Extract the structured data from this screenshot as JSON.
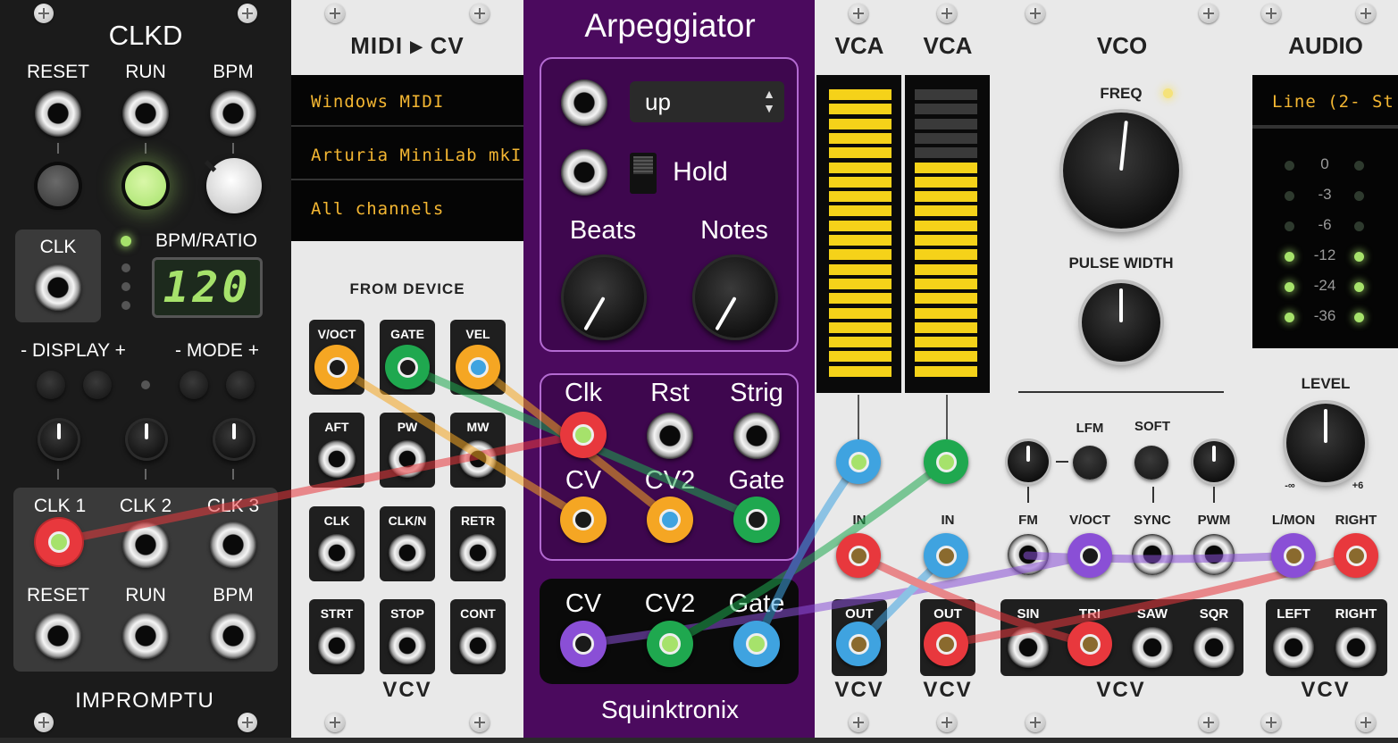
{
  "clkd": {
    "title": "CLKD",
    "top_labels": [
      "RESET",
      "RUN",
      "BPM"
    ],
    "clk_label": "CLK",
    "bpm_ratio_label": "BPM/RATIO",
    "display_value": "120",
    "display_label": "- DISPLAY +",
    "mode_label": "- MODE +",
    "out_labels": [
      "CLK 1",
      "CLK 2",
      "CLK 3"
    ],
    "bottom_labels": [
      "RESET",
      "RUN",
      "BPM"
    ],
    "brand": "IMPROMPTU"
  },
  "midicv": {
    "title": "MIDI ▸ CV",
    "driver": "Windows MIDI",
    "device": "Arturia MiniLab mkI",
    "channel": "All channels",
    "section_label": "FROM DEVICE",
    "outputs": [
      "V/OCT",
      "GATE",
      "VEL",
      "AFT",
      "PW",
      "MW",
      "CLK",
      "CLK/N",
      "RETR",
      "STRT",
      "STOP",
      "CONT"
    ],
    "brand": "VCV"
  },
  "arp": {
    "title": "Arpeggiator",
    "mode_value": "up",
    "hold_label": "Hold",
    "beats_label": "Beats",
    "notes_label": "Notes",
    "inputs": [
      "Clk",
      "Rst",
      "Strig",
      "CV",
      "CV2",
      "Gate"
    ],
    "outputs": [
      "CV",
      "CV2",
      "Gate"
    ],
    "brand": "Squinktronix"
  },
  "vca1": {
    "title": "VCA",
    "in_label": "IN",
    "out_label": "OUT",
    "brand": "VCV",
    "level": 1.0
  },
  "vca2": {
    "title": "VCA",
    "in_label": "IN",
    "out_label": "OUT",
    "brand": "VCV",
    "level": 0.75
  },
  "vco": {
    "title": "VCO",
    "freq_label": "FREQ",
    "pw_label": "PULSE WIDTH",
    "lfm_label": "LFM",
    "soft_label": "SOFT",
    "inputs": [
      "FM",
      "V/OCT",
      "SYNC",
      "PWM"
    ],
    "outputs": [
      "SIN",
      "TRI",
      "SAW",
      "SQR"
    ],
    "brand": "VCV"
  },
  "audio": {
    "title": "AUDIO",
    "device": "Line (2- St",
    "meter_labels": [
      "0",
      "-3",
      "-6",
      "-12",
      "-24",
      "-36"
    ],
    "level_label": "LEVEL",
    "level_min": "-∞",
    "level_max": "+6",
    "inputs": [
      "L/MON",
      "RIGHT"
    ],
    "outputs": [
      "LEFT",
      "RIGHT"
    ],
    "brand": "VCV"
  },
  "colors": {
    "yellow": "#f5d219",
    "purple": "#4a0b5c",
    "cable_red": "#e8383d",
    "cable_orange": "#f5a623",
    "cable_green": "#1fa84f",
    "cable_blue": "#3fa3e0",
    "cable_violet": "#8a4fd6"
  }
}
